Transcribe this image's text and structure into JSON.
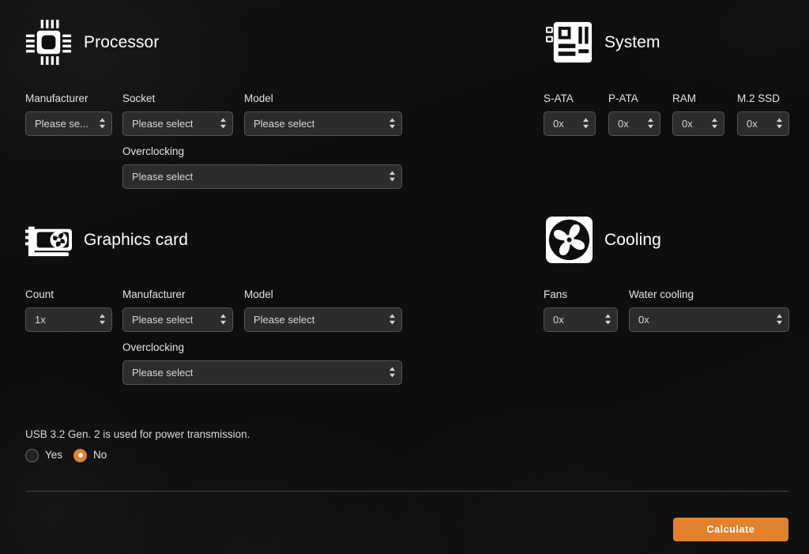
{
  "theme": {
    "background": "#0e0e0e",
    "accent": "#e2822f",
    "select_fill": "#2c2c2c",
    "select_border": "#565656",
    "text": "#e8e8e8"
  },
  "sections": {
    "processor": {
      "icon": "cpu-chip-icon",
      "title": "Processor",
      "fields": {
        "manufacturer": {
          "label": "Manufacturer",
          "value": "Please se..."
        },
        "socket": {
          "label": "Socket",
          "value": "Please select"
        },
        "model": {
          "label": "Model",
          "value": "Please select"
        },
        "overclocking": {
          "label": "Overclocking",
          "value": "Please select"
        }
      }
    },
    "system": {
      "icon": "motherboard-icon",
      "title": "System",
      "fields": {
        "sata": {
          "label": "S-ATA",
          "value": "0x"
        },
        "pata": {
          "label": "P-ATA",
          "value": "0x"
        },
        "ram": {
          "label": "RAM",
          "value": "0x"
        },
        "m2ssd": {
          "label": "M.2 SSD",
          "value": "0x"
        }
      }
    },
    "graphics": {
      "icon": "graphics-card-icon",
      "title": "Graphics card",
      "fields": {
        "count": {
          "label": "Count",
          "value": "1x"
        },
        "manufacturer": {
          "label": "Manufacturer",
          "value": "Please select"
        },
        "model": {
          "label": "Model",
          "value": "Please select"
        },
        "overclocking": {
          "label": "Overclocking",
          "value": "Please select"
        }
      }
    },
    "cooling": {
      "icon": "fan-icon",
      "title": "Cooling",
      "fields": {
        "fans": {
          "label": "Fans",
          "value": "0x"
        },
        "water_cooling": {
          "label": "Water cooling",
          "value": "0x"
        }
      }
    }
  },
  "usb_question": {
    "text": "USB 3.2 Gen. 2 is used for power transmission.",
    "options": [
      {
        "label": "Yes",
        "selected": false
      },
      {
        "label": "No",
        "selected": true
      }
    ]
  },
  "footer": {
    "calculate_label": "Calculate"
  }
}
